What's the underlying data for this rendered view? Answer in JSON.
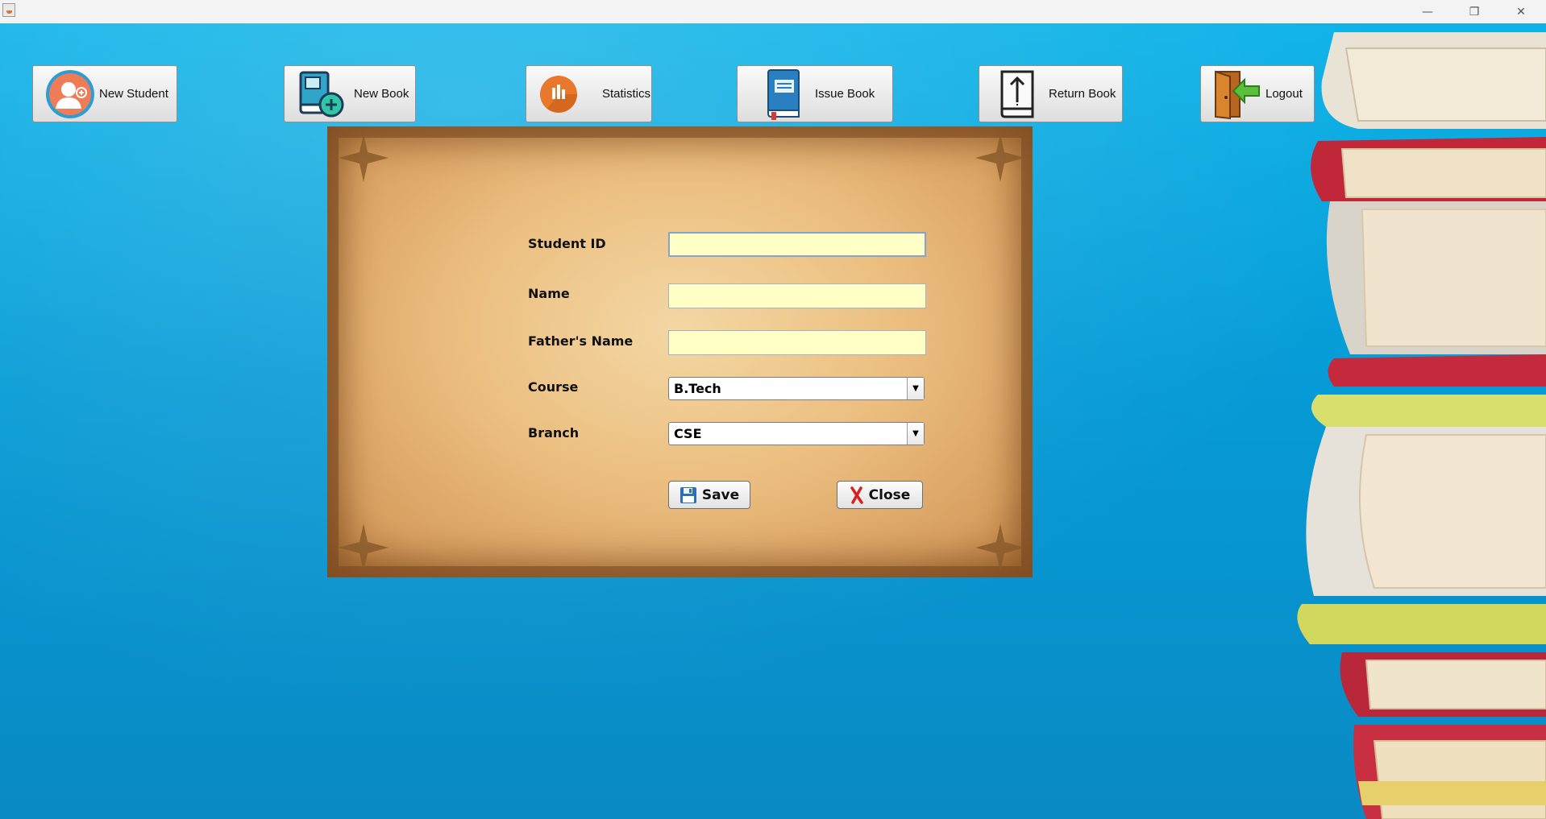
{
  "window": {
    "minimize_glyph": "—",
    "restore_glyph": "❐",
    "close_glyph": "✕"
  },
  "toolbar": [
    {
      "label": "New Student",
      "icon": "new-student-icon"
    },
    {
      "label": "New Book",
      "icon": "new-book-icon"
    },
    {
      "label": "Statistics",
      "icon": "statistics-icon"
    },
    {
      "label": "Issue Book",
      "icon": "issue-book-icon"
    },
    {
      "label": "Return Book",
      "icon": "return-book-icon"
    },
    {
      "label": "Logout",
      "icon": "logout-icon"
    }
  ],
  "form": {
    "student_id_label": "Student ID",
    "student_id_value": "",
    "name_label": "Name",
    "name_value": "",
    "father_label": "Father's Name",
    "father_value": "",
    "course_label": "Course",
    "course_value": "B.Tech",
    "branch_label": "Branch",
    "branch_value": "CSE",
    "save_label": "Save",
    "close_label": "Close"
  },
  "colors": {
    "desktop": "#0b8fc9",
    "input_bg": "#ffffc6",
    "parchment": "#ebbe7f"
  }
}
